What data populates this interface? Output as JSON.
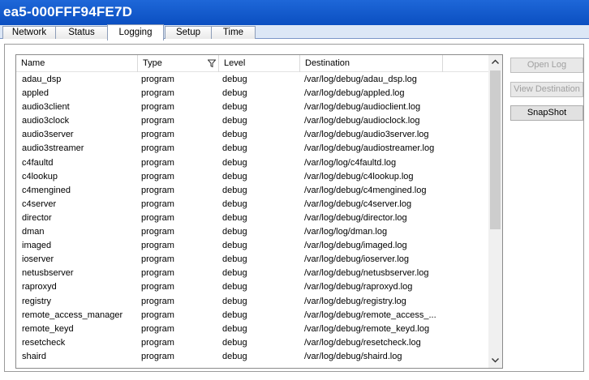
{
  "window": {
    "title": "ea5-000FFF94FE7D"
  },
  "tabs": [
    {
      "label": "Network"
    },
    {
      "label": "Status"
    },
    {
      "label": "Logging"
    },
    {
      "label": "Setup"
    },
    {
      "label": "Time"
    }
  ],
  "active_tab": "Logging",
  "grid": {
    "columns": [
      "Name",
      "Type",
      "Level",
      "Destination"
    ],
    "filter_icon": "filter-icon",
    "rows": [
      [
        "adau_dsp",
        "program",
        "debug",
        "/var/log/debug/adau_dsp.log"
      ],
      [
        "appled",
        "program",
        "debug",
        "/var/log/debug/appled.log"
      ],
      [
        "audio3client",
        "program",
        "debug",
        "/var/log/debug/audioclient.log"
      ],
      [
        "audio3clock",
        "program",
        "debug",
        "/var/log/debug/audioclock.log"
      ],
      [
        "audio3server",
        "program",
        "debug",
        "/var/log/debug/audio3server.log"
      ],
      [
        "audio3streamer",
        "program",
        "debug",
        "/var/log/debug/audiostreamer.log"
      ],
      [
        "c4faultd",
        "program",
        "debug",
        "/var/log/log/c4faultd.log"
      ],
      [
        "c4lookup",
        "program",
        "debug",
        "/var/log/debug/c4lookup.log"
      ],
      [
        "c4mengined",
        "program",
        "debug",
        "/var/log/debug/c4mengined.log"
      ],
      [
        "c4server",
        "program",
        "debug",
        "/var/log/debug/c4server.log"
      ],
      [
        "director",
        "program",
        "debug",
        "/var/log/debug/director.log"
      ],
      [
        "dman",
        "program",
        "debug",
        "/var/log/log/dman.log"
      ],
      [
        "imaged",
        "program",
        "debug",
        "/var/log/debug/imaged.log"
      ],
      [
        "ioserver",
        "program",
        "debug",
        "/var/log/debug/ioserver.log"
      ],
      [
        "netusbserver",
        "program",
        "debug",
        "/var/log/debug/netusbserver.log"
      ],
      [
        "raproxyd",
        "program",
        "debug",
        "/var/log/debug/raproxyd.log"
      ],
      [
        "registry",
        "program",
        "debug",
        "/var/log/debug/registry.log"
      ],
      [
        "remote_access_manager",
        "program",
        "debug",
        "/var/log/debug/remote_access_..."
      ],
      [
        "remote_keyd",
        "program",
        "debug",
        "/var/log/debug/remote_keyd.log"
      ],
      [
        "resetcheck",
        "program",
        "debug",
        "/var/log/debug/resetcheck.log"
      ],
      [
        "shaird",
        "program",
        "debug",
        "/var/log/debug/shaird.log"
      ]
    ]
  },
  "buttons": {
    "open_log": "Open Log",
    "view_destination": "View Destination",
    "snapshot": "SnapShot"
  }
}
